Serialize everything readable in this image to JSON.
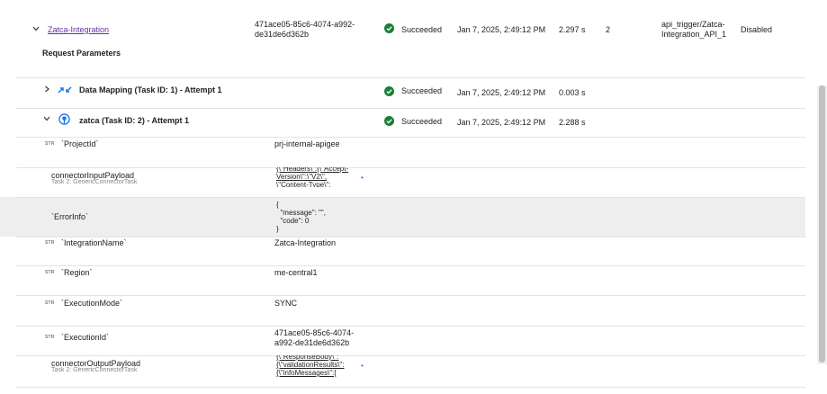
{
  "top_row": {
    "name": "Zatca-Integration",
    "execution_id": "471ace05-85c6-4074-a992-\nde31de6d362b",
    "status": "Succeeded",
    "timestamp": "Jan 7, 2025, 2:49:12 PM",
    "duration": "2.297 s",
    "count": "2",
    "trigger": "api_trigger/Zatca-\nIntegration_API_1",
    "state": "Disabled"
  },
  "request_parameters_label": "Request Parameters",
  "tasks": [
    {
      "name": "Data Mapping (Task ID: 1) - Attempt 1",
      "status": "Succeeded",
      "timestamp": "Jan 7, 2025, 2:49:12 PM",
      "duration": "0.003 s",
      "icon": "data-mapping-icon"
    },
    {
      "name": "zatca (Task ID: 2) - Attempt 1",
      "status": "Succeeded",
      "timestamp": "Jan 7, 2025, 2:49:12 PM",
      "duration": "2.288 s",
      "icon": "connector-icon"
    }
  ],
  "str_tag": "STR",
  "params": {
    "project_id": {
      "name": "`ProjectId`",
      "value": "prj-internal-apigee"
    },
    "connector_input": {
      "name": "connectorInputPayload",
      "sub": "Task 2: GenericConnectorTask",
      "value": "{\\\"Headers\\\":{\\\"Accept-\nVersion\\\":\\\"V2\\\",\n\\\"Content-Type\\\":"
    },
    "error_info": {
      "name": "`ErrorInfo`",
      "value": "{\n  \"message\": \"\",\n  \"code\": 0\n}"
    },
    "integration_name": {
      "name": "`IntegrationName`",
      "value": "Zatca-Integration"
    },
    "region": {
      "name": "`Region`",
      "value": "me-central1"
    },
    "execution_mode": {
      "name": "`ExecutionMode`",
      "value": "SYNC"
    },
    "execution_id": {
      "name": "`ExecutionId`",
      "value": "471ace05-85c6-4074-\na992-de31de6d362b"
    },
    "connector_output": {
      "name": "connectorOutputPayload",
      "sub": "Task 2: GenericConnectorTask",
      "value": "{\\\"ResponseBody\\\":\n{\\\"validationResults\\\":\n{\\\"infoMessages\\\":["
    }
  },
  "colors": {
    "success": "#188038",
    "link": "#6a2fa0",
    "shade": "#eeeeee",
    "divider": "#e3e3e3"
  }
}
